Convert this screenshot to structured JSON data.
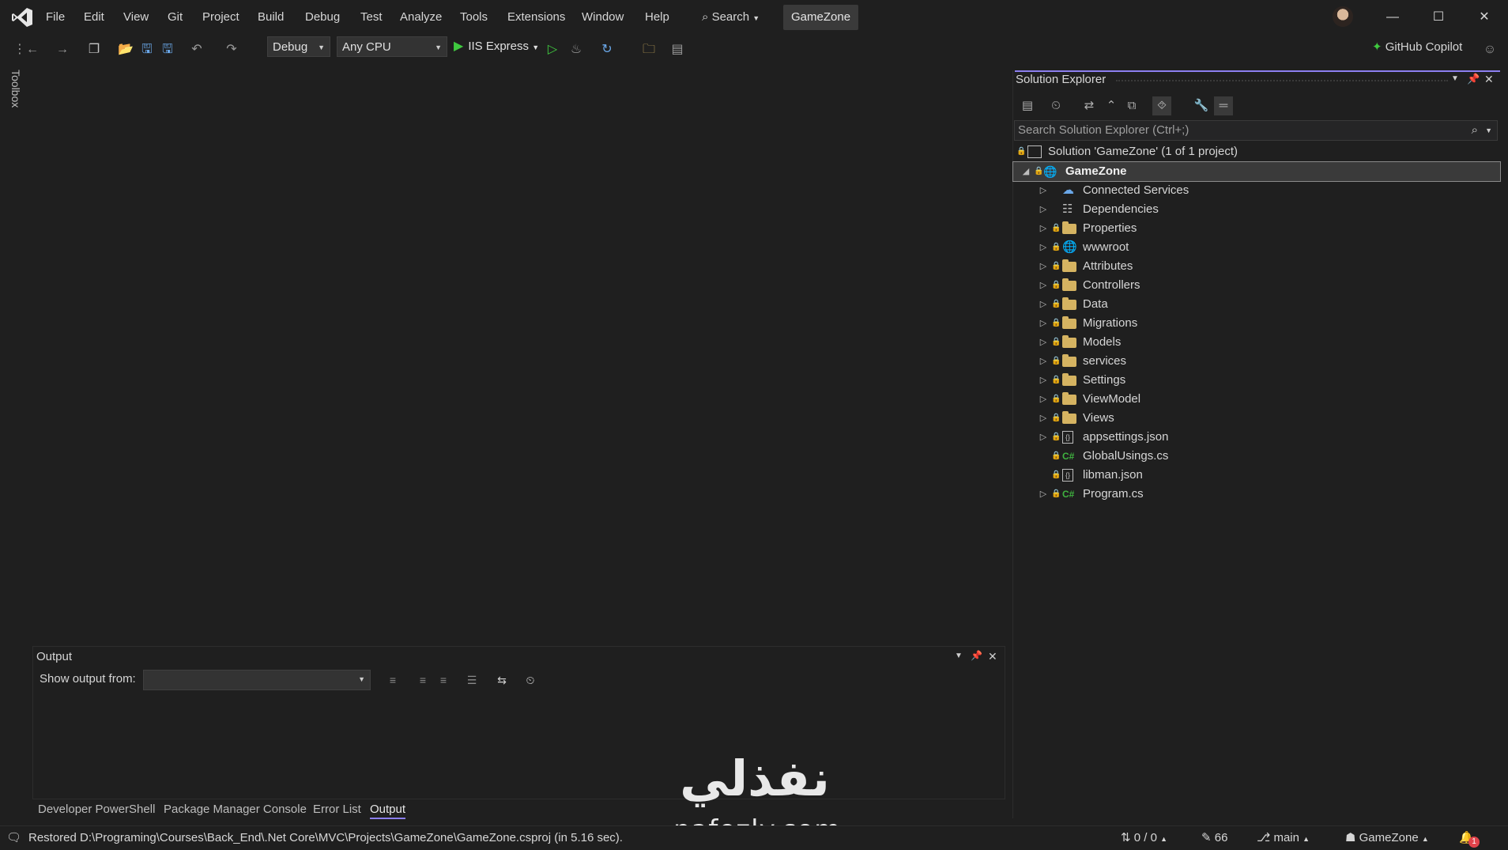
{
  "menu": [
    "File",
    "Edit",
    "View",
    "Git",
    "Project",
    "Build",
    "Debug",
    "Test",
    "Analyze",
    "Tools",
    "Extensions",
    "Window",
    "Help"
  ],
  "search_label": "Search",
  "solution_button": "GameZone",
  "toolbar": {
    "config": "Debug",
    "platform": "Any CPU",
    "run_target": "IIS Express",
    "copilot": "GitHub Copilot"
  },
  "toolbox_label": "Toolbox",
  "solution_explorer": {
    "title": "Solution Explorer",
    "search_placeholder": "Search Solution Explorer (Ctrl+;)",
    "solution_label": "Solution 'GameZone' (1 of 1 project)",
    "project": "GameZone",
    "items": [
      {
        "label": "Connected Services",
        "icon": "connected-services-icon",
        "expandable": true,
        "locked": false
      },
      {
        "label": "Dependencies",
        "icon": "dependencies-icon",
        "expandable": true,
        "locked": false
      },
      {
        "label": "Properties",
        "icon": "properties-icon",
        "expandable": true,
        "locked": true
      },
      {
        "label": "wwwroot",
        "icon": "globe-icon",
        "expandable": true,
        "locked": true
      },
      {
        "label": "Attributes",
        "icon": "folder-icon",
        "expandable": true,
        "locked": true
      },
      {
        "label": "Controllers",
        "icon": "folder-icon",
        "expandable": true,
        "locked": true
      },
      {
        "label": "Data",
        "icon": "folder-icon",
        "expandable": true,
        "locked": true
      },
      {
        "label": "Migrations",
        "icon": "folder-icon",
        "expandable": true,
        "locked": true
      },
      {
        "label": "Models",
        "icon": "folder-icon",
        "expandable": true,
        "locked": true
      },
      {
        "label": "services",
        "icon": "folder-icon",
        "expandable": true,
        "locked": true
      },
      {
        "label": "Settings",
        "icon": "folder-icon",
        "expandable": true,
        "locked": true
      },
      {
        "label": "ViewModel",
        "icon": "folder-icon",
        "expandable": true,
        "locked": true
      },
      {
        "label": "Views",
        "icon": "folder-icon",
        "expandable": true,
        "locked": true
      },
      {
        "label": "appsettings.json",
        "icon": "json-file-icon",
        "expandable": true,
        "locked": true
      },
      {
        "label": "GlobalUsings.cs",
        "icon": "csharp-file-icon",
        "expandable": false,
        "locked": true
      },
      {
        "label": "libman.json",
        "icon": "json-file-icon",
        "expandable": false,
        "locked": true
      },
      {
        "label": "Program.cs",
        "icon": "csharp-file-icon",
        "expandable": true,
        "locked": true
      }
    ]
  },
  "output": {
    "title": "Output",
    "show_from_label": "Show output from:",
    "show_from_value": ""
  },
  "bottom_tabs": [
    "Developer PowerShell",
    "Package Manager Console",
    "Error List",
    "Output"
  ],
  "status": {
    "message": "Restored D:\\Programing\\Courses\\Back_End\\.Net Core\\MVC\\Projects\\GameZone\\GameZone.csproj (in 5.16 sec).",
    "sync": "0 / 0",
    "edits": "66",
    "branch": "main",
    "repo": "GameZone",
    "notifications": "1"
  },
  "watermark": {
    "arabic": "نفذلي",
    "latin": "nafezly.com"
  },
  "colors": {
    "accent": "#8c7ff0",
    "run": "#3fc93f",
    "folder": "#d5b361",
    "csharp": "#3fb23f",
    "background": "#1f1f1f"
  }
}
